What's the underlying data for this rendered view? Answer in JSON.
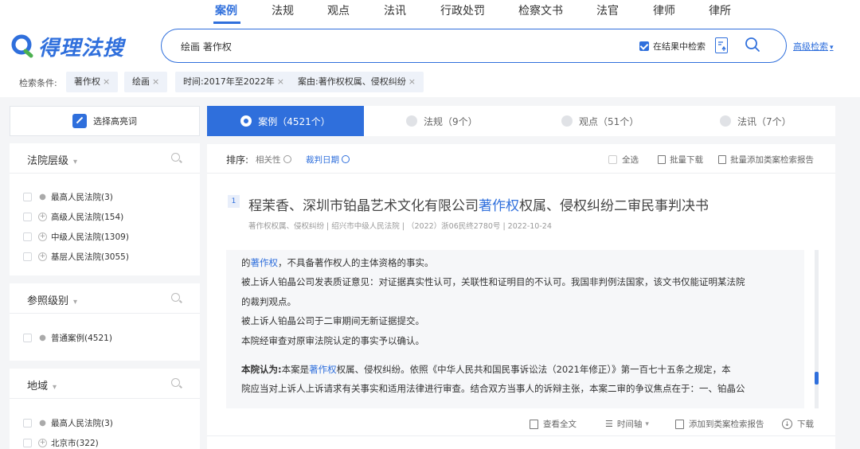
{
  "nav": {
    "items": [
      "案例",
      "法规",
      "观点",
      "法讯",
      "行政处罚",
      "检察文书",
      "法官",
      "律师",
      "律所"
    ],
    "active": "案例"
  },
  "header": {
    "logo_text": "得理法搜",
    "search_value": "绘画 著作权",
    "in_result_label": "在结果中检索",
    "advanced_search": "高级检索",
    "advanced_caret": "▾"
  },
  "filters": {
    "label": "检索条件:",
    "chips": [
      "著作权",
      "绘画",
      "时间:2017年至2022年",
      "案由:著作权权属、侵权纠纷"
    ],
    "remove_glyph": "×"
  },
  "sidebar": {
    "highlight_button": "选择高亮词",
    "court_level": {
      "title": "法院层级",
      "options": [
        {
          "marker": "●",
          "label": "最高人民法院(3)"
        },
        {
          "marker": "+",
          "label": "高级人民法院(154)"
        },
        {
          "marker": "+",
          "label": "中级人民法院(1309)"
        },
        {
          "marker": "+",
          "label": "基层人民法院(3055)"
        }
      ]
    },
    "reference_level": {
      "title": "参照级别",
      "options": [
        {
          "marker": "●",
          "label": "普通案例(4521)"
        }
      ]
    },
    "region": {
      "title": "地域",
      "options": [
        {
          "marker": "●",
          "label": "最高人民法院(3)"
        },
        {
          "marker": "+",
          "label": "北京市(322)"
        }
      ]
    },
    "caret": "▾"
  },
  "tabs": [
    {
      "label": "案例（4521个）",
      "active": true
    },
    {
      "label": "法规（9个）",
      "active": false
    },
    {
      "label": "观点（51个）",
      "active": false
    },
    {
      "label": "法讯（7个）",
      "active": false
    }
  ],
  "sortbar": {
    "label": "排序:",
    "relevance": "相关性",
    "judgment_date": "裁判日期",
    "select_all": "全选",
    "batch_download": "批量下载",
    "batch_add_report": "批量添加类案检索报告"
  },
  "result": {
    "index": "1",
    "title_pre": "程茉香、深圳市铂晶艺术文化有限公司",
    "title_hl": "著作权",
    "title_post": "权属、侵权纠纷二审民事判决书",
    "meta": "著作权权属、侵权纠纷 | 绍兴市中级人民法院 | （2022）浙06民终2780号 | 2022-10-24",
    "excerpt": {
      "line1_pre": "的",
      "line1_hl": "著作权",
      "line1_post": "，不具备著作权人的主体资格的事实。",
      "line2": "被上诉人铂晶公司发表质证意见：对证据真实性认可，关联性和证明目的不认可。我国非判例法国家，该文书仅能证明某法院",
      "line3": "的裁判观点。",
      "line4": "被上诉人铂晶公司于二审期间无新证据提交。",
      "line5": "本院经审查对原审法院认定的事实予以确认。",
      "line6_bold": "本院认为:",
      "line6_pre": "本案是",
      "line6_hl": "著作权",
      "line6_post": "权属、侵权纠纷。依照《中华人民共和国民事诉讼法（2021年修正）》第一百七十五条之规定，本",
      "line7": "院应当对上诉人上诉请求有关事实和适用法律进行审查。结合双方当事人的诉辩主张，本案二审的争议焦点在于：一、铂晶公"
    },
    "actions": {
      "view_full": "查看全文",
      "timeline": "时间轴",
      "add_report": "添加到类案检索报告",
      "download": "下载"
    }
  },
  "colors": {
    "accent": "#2f6fdc"
  }
}
